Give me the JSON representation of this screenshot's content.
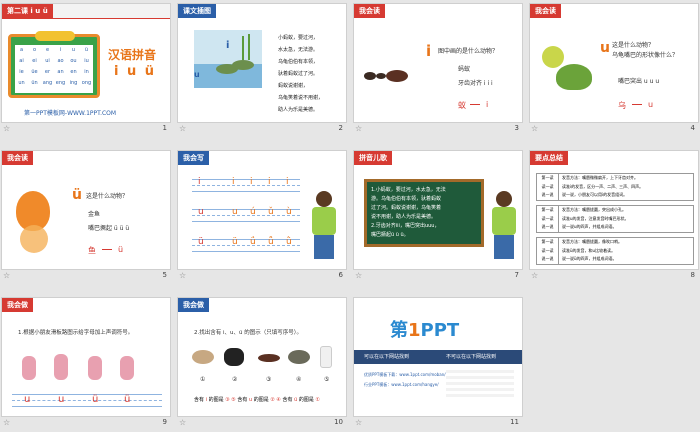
{
  "slides": [
    {
      "num": "1",
      "tag": "第二课 i u ü",
      "title": "汉语拼音",
      "pinyin": "i u ü",
      "footer": "第一PPT模板网-WWW.1PPT.COM",
      "chart_rows": [
        [
          "a",
          "o",
          "e",
          "i",
          "u",
          "ü"
        ],
        [
          "ai",
          "ei",
          "ui",
          "ao",
          "ou",
          "iu"
        ],
        [
          "ie",
          "üe",
          "er",
          "an",
          "en",
          "in"
        ],
        [
          "un",
          "ün",
          "ang",
          "eng",
          "ing",
          "ong"
        ]
      ]
    },
    {
      "num": "2",
      "tag": "课文插图",
      "poem": [
        "小蚂蚁，要过河，",
        "水太急，无法游。",
        "乌龟伯伯有本领，",
        "驮着蚂蚁过了河。",
        "蚂蚁说谢谢，",
        "乌龟笑着说不用谢，",
        "助人为乐是美德。"
      ],
      "letter_i": "i",
      "letter_u": "u"
    },
    {
      "num": "3",
      "tag": "我会读",
      "big": "i",
      "question": "图中画的是什么动物？",
      "answer": "蚂蚁",
      "mnemonic": "牙齿对齐 i i i",
      "pair_left": "蚁",
      "pair_right": "i"
    },
    {
      "num": "4",
      "tag": "我会读",
      "big": "u",
      "question": "这是什么动物？",
      "question2": "乌龟嘴巴的形状像什么？",
      "mnemonic": "嘴巴突出 u u u",
      "pair_left": "乌",
      "pair_right": "u"
    },
    {
      "num": "5",
      "tag": "我会读",
      "big": "ü",
      "question": "这是什么动物？",
      "answer": "金鱼",
      "mnemonic": "嘴巴撅起 ü ü ü",
      "pair_left": "鱼",
      "pair_right": "ü"
    },
    {
      "num": "6",
      "tag": "我会写",
      "rows": [
        [
          "i",
          "i",
          "i",
          "i"
        ],
        [
          "u",
          "ú",
          "ǔ",
          "ù"
        ],
        [
          "ü",
          "ǘ",
          "ǚ",
          "ǜ"
        ]
      ],
      "first": [
        "i",
        "u",
        "ü"
      ]
    },
    {
      "num": "7",
      "tag": "拼音儿歌",
      "board": [
        "1.小蚂蚁，要过河，水太急，无法",
        "游。乌龟伯伯有本领，驮着蚂蚁",
        "过了河。蚂蚁说谢谢，乌龟笑着",
        "说不用谢，助人为乐是美德。",
        "2.牙齿对齐iii，嘴巴突出uuu，",
        "嘴巴撅起ü ü ü。"
      ]
    },
    {
      "num": "8",
      "tag": "要点总结",
      "blocks": [
        {
          "labels": [
            "第一读",
            "读一读",
            "说一说"
          ],
          "lines": [
            "发音方法：嘴唇微微扁开，上下牙齿对齐。",
            "读准i的发音，区分一声、二声、三声、四声。",
            "说一说，小朋友可以用i的发音组词。"
          ]
        },
        {
          "labels": [
            "第一读",
            "读一读",
            "说一说"
          ],
          "lines": [
            "发音方法：嘴唇拢圆，突出成小孔。",
            "读准u的发音，注意发音时嘴巴形状。",
            "说一说u的四声，并组成词语。"
          ]
        },
        {
          "labels": [
            "第一读",
            "读一读",
            "说一说"
          ],
          "lines": [
            "发音方法：嘴唇拢圆，像吹口哨。",
            "读准ü的发音，和u比较着读。",
            "说一说ü的四声，并组成词语。"
          ]
        }
      ]
    },
    {
      "num": "9",
      "tag": "我会做",
      "instruction": "1.根据小朋友滑板路图示给字母加上声调符号。",
      "letters": [
        "u",
        "u",
        "ü",
        "ü"
      ]
    },
    {
      "num": "10",
      "tag": "我会做",
      "instruction": "2.找出含有 i、u、ü 的图示（只填写序号）。",
      "marks": [
        "①",
        "②",
        "③",
        "④",
        "⑤"
      ],
      "answer_prefix": "含有",
      "answer_suffix": "的图是"
    },
    {
      "num": "11",
      "logo": "第1PPT",
      "logo_main": "第",
      "logo_num": "1",
      "logo_rest": "PPT",
      "line1a": "可以在以下网站找到",
      "line1b": "不可以在以下网站找到",
      "sub1": "优质PPT模板下载：www.1ppt.com/moban/",
      "sub2": "行业PPT模板：www.1ppt.com/hangye/"
    }
  ]
}
